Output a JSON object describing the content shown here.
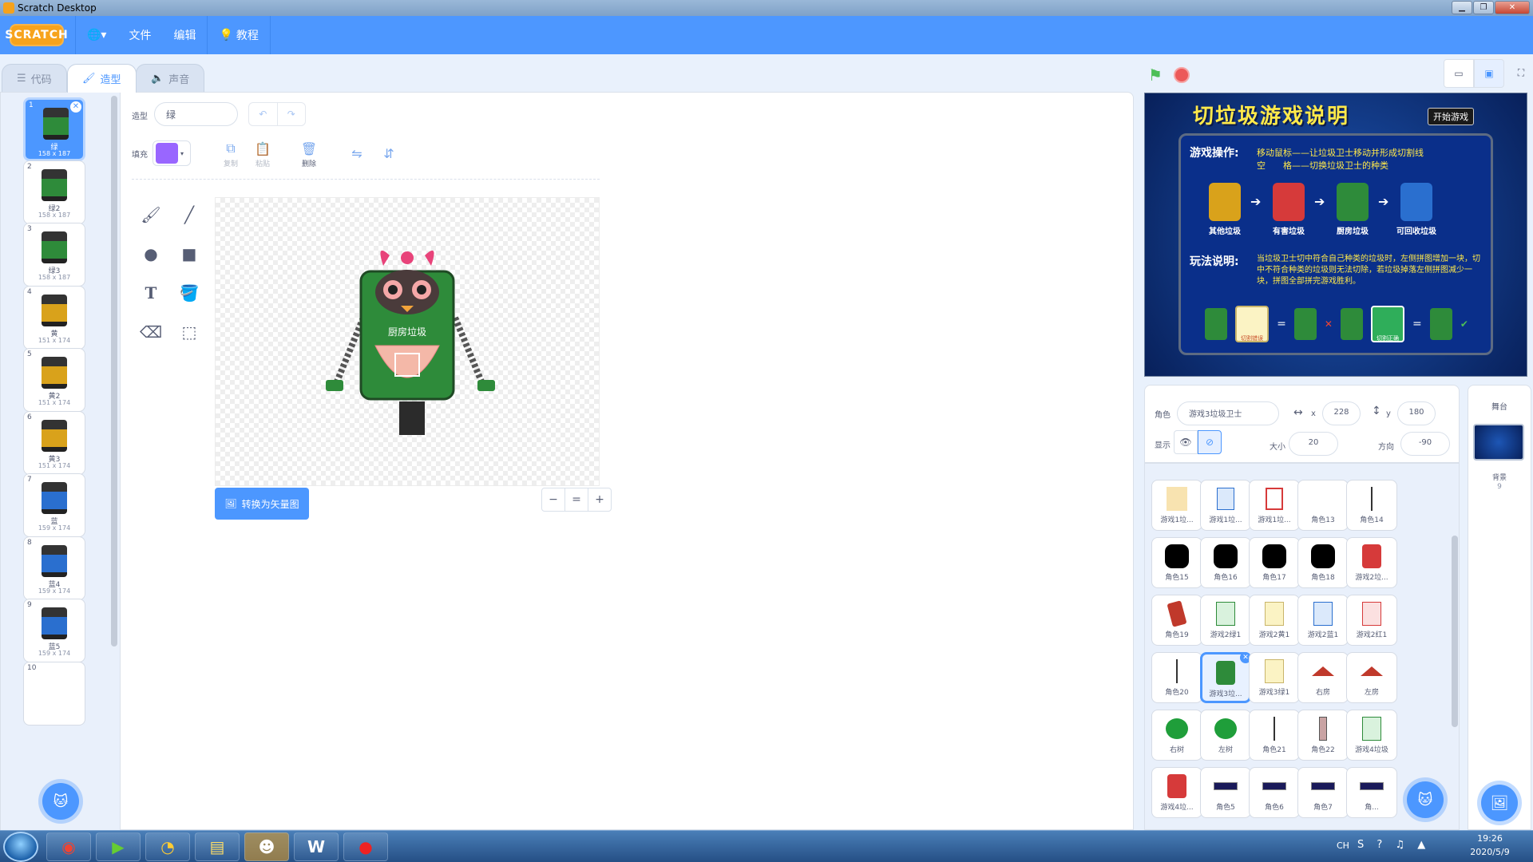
{
  "window": {
    "title": "Scratch Desktop",
    "min": "▁",
    "max": "❐",
    "close": "✕"
  },
  "menu": {
    "logo": "SCRATCH",
    "language": "🌐▾",
    "file": "文件",
    "edit": "编辑",
    "tutorials": "教程"
  },
  "tabs": [
    {
      "label": "代码"
    },
    {
      "label": "造型"
    },
    {
      "label": "声音"
    }
  ],
  "costumes": [
    {
      "num": "1",
      "name": "绿",
      "size": "158 x 187",
      "selected": true
    },
    {
      "num": "2",
      "name": "绿2",
      "size": "158 x 187"
    },
    {
      "num": "3",
      "name": "绿3",
      "size": "158 x 187"
    },
    {
      "num": "4",
      "name": "黄",
      "size": "151 x 174"
    },
    {
      "num": "5",
      "name": "黄2",
      "size": "151 x 174"
    },
    {
      "num": "6",
      "name": "黄3",
      "size": "151 x 174"
    },
    {
      "num": "7",
      "name": "蓝",
      "size": "159 x 174"
    },
    {
      "num": "8",
      "name": "蓝4",
      "size": "159 x 174"
    },
    {
      "num": "9",
      "name": "蓝5",
      "size": "159 x 174"
    },
    {
      "num": "10",
      "name": "",
      "size": ""
    }
  ],
  "editor": {
    "costume_label": "造型",
    "costume_name": "绿",
    "fill_label": "填充",
    "fill_color": "#9966ff",
    "copy_label": "复制",
    "paste_label": "粘贴",
    "delete_label": "删除",
    "convert_label": "转换为矢量图",
    "zoom_out": "−",
    "zoom_reset": "=",
    "zoom_in": "+",
    "robot_label": "厨房垃圾"
  },
  "stage": {
    "title": "切垃圾游戏说明",
    "start_btn": "开始游戏",
    "ops_label": "游戏操作:",
    "ops_line1": "移动鼠标——让垃圾卫士移动并形成切割线",
    "ops_line2": "空　　格——切换垃圾卫士的种类",
    "kinds": [
      "其他垃圾",
      "有害垃圾",
      "厨房垃圾",
      "可回收垃圾"
    ],
    "rules_label": "玩法说明:",
    "rules_text": "当垃圾卫士切中符合自己种类的垃圾时，左侧拼图增加一块，切中不符合种类的垃圾则无法切除，若垃圾掉落左侧拼图减少一块，拼图全部拼完游戏胜利。",
    "bottom_tag1": "切割错误",
    "bottom_tag2": "切割正确"
  },
  "sprite_info": {
    "sprite_label": "角色",
    "sprite_name": "游戏3垃圾卫士",
    "x_label": "x",
    "x": "228",
    "y_label": "y",
    "y": "180",
    "show_label": "显示",
    "size_label": "大小",
    "size": "20",
    "direction_label": "方向",
    "direction": "-90"
  },
  "sprites": [
    {
      "name": "游戏1垃...",
      "icon": "bag-icon"
    },
    {
      "name": "游戏1垃...",
      "icon": "recycle-icon"
    },
    {
      "name": "游戏1垃...",
      "icon": "hazard-icon"
    },
    {
      "name": "角色13",
      "icon": "blank"
    },
    {
      "name": "角色14",
      "icon": "line-icon"
    },
    {
      "name": "角色15",
      "icon": "octagon-icon"
    },
    {
      "name": "角色16",
      "icon": "octagon-icon"
    },
    {
      "name": "角色17",
      "icon": "octagon-icon"
    },
    {
      "name": "角色18",
      "icon": "octagon-icon"
    },
    {
      "name": "游戏2垃...",
      "icon": "robot-red-icon"
    },
    {
      "name": "角色19",
      "icon": "red-bin-icon"
    },
    {
      "name": "游戏2绿1",
      "icon": "green-card-icon"
    },
    {
      "name": "游戏2黄1",
      "icon": "yellow-card-icon"
    },
    {
      "name": "游戏2蓝1",
      "icon": "blue-card-icon"
    },
    {
      "name": "游戏2红1",
      "icon": "red-card-icon"
    },
    {
      "name": "角色20",
      "icon": "line-icon"
    },
    {
      "name": "游戏3垃...",
      "icon": "robot-green-icon",
      "selected": true
    },
    {
      "name": "游戏3绿1",
      "icon": "yellow-card-icon"
    },
    {
      "name": "右房",
      "icon": "house-icon"
    },
    {
      "name": "左房",
      "icon": "house-icon"
    },
    {
      "name": "右树",
      "icon": "tree-icon"
    },
    {
      "name": "左树",
      "icon": "tree-icon"
    },
    {
      "name": "角色21",
      "icon": "line-icon"
    },
    {
      "name": "角色22",
      "icon": "bar-icon"
    },
    {
      "name": "游戏4垃圾",
      "icon": "green-card-icon"
    },
    {
      "name": "游戏4垃...",
      "icon": "robot-red-icon"
    },
    {
      "name": "角色5",
      "icon": "button-icon"
    },
    {
      "name": "角色6",
      "icon": "button-icon"
    },
    {
      "name": "角色7",
      "icon": "button-icon"
    },
    {
      "name": "角...",
      "icon": "button-icon"
    }
  ],
  "stage_panel": {
    "title": "舞台",
    "backdrop_label": "背景",
    "backdrop_count": "9"
  },
  "taskbar": {
    "lang": "CH",
    "time": "19:26",
    "date": "2020/5/9"
  },
  "colors": {
    "accent": "#4c97ff",
    "menubar": "#4d97ff",
    "flag": "#4cbf56",
    "stop": "#ec5959"
  }
}
